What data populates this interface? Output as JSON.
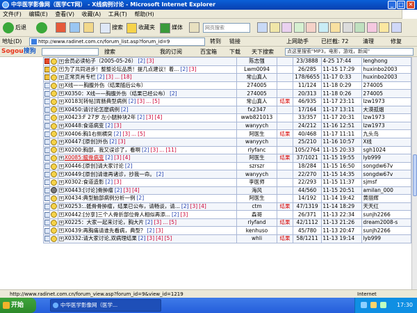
{
  "window": {
    "title": "中华医学影像网（医学CT网） - X线病例讨论 - Microsoft Internet Explorer"
  },
  "menu": [
    "文件(F)",
    "编辑(E)",
    "查看(V)",
    "收藏(A)",
    "工具(T)",
    "帮助(H)"
  ],
  "toolbar": {
    "back": "后退",
    "search": "搜索",
    "favorites": "收藏夹",
    "media": "媒体",
    "web_search_placeholder": "网页搜索",
    "sogou_input": "上网助手",
    "block_ads": "已拦截: 72",
    "clean": "清理",
    "repair": "修复"
  },
  "address": {
    "label": "地址(D)",
    "url": "http://www.radinet.com.cn/forum_list.asp?forum_id=9",
    "go": "转到",
    "links": [
      "链接",
      "上网助手",
      "已拦截: 72",
      "清理",
      "修复"
    ]
  },
  "sogou_bar": {
    "logo_a": "Sogou",
    "logo_b": "搜狗",
    "search": "搜索",
    "items": [
      "我的订阅",
      "百宝箱",
      "下载",
      "天下搜索"
    ],
    "hot": "点这里搜索\"MP3，电影，游戏，新闻\""
  },
  "threads": [
    {
      "icon": "hot",
      "face": "normal",
      "title": "会员必读帖子（2005-05-26）",
      "pages": [
        "[2]",
        "[3]"
      ],
      "author": "陈志强",
      "tag": "",
      "counts": "23/3888",
      "last": "4-25 17:44",
      "last_user": "lenghong"
    },
    {
      "icon": "pic",
      "face": "normal",
      "title": "为了共同进步！整整论坛品质！提几点建议！着...",
      "pages": [
        "[2]",
        "[3]"
      ],
      "author": "Lwm0094",
      "tag": "",
      "counts": "26/285",
      "last": "11-15 17:29",
      "last_user": "huxinbo2003"
    },
    {
      "icon": "pic",
      "face": "normal",
      "title": "正常页肖专栏",
      "pages": [
        "[2]",
        "[3]",
        "...",
        "[18]"
      ],
      "author": "常山真人",
      "tag": "",
      "counts": "178/6655",
      "last": "11-17 0:33",
      "last_user": "huxinbo2003"
    },
    {
      "icon": "normal",
      "face": "normal",
      "title": "X线——胸腹外伤（结果随后公布）",
      "pages": [],
      "author": "274005",
      "tag": "",
      "counts": "11/124",
      "last": "11-18 0:29",
      "last_user": "274005"
    },
    {
      "icon": "normal",
      "face": "normal",
      "title": "X0350：X线——胸腹外伤（结果已经公布）",
      "pages": [
        "[2]"
      ],
      "author": "274005",
      "tag": "",
      "counts": "20/313",
      "last": "11-18 0:26",
      "last_user": "274005"
    },
    {
      "icon": "normal",
      "face": "normal",
      "title": "X0183[转帖]胃肠典型病例",
      "pages": [
        "[2]",
        "[3]",
        "...",
        "[5]"
      ],
      "author": "常山真人",
      "tag": "结果",
      "counts": "46/935",
      "last": "11-17 23:11",
      "last_user": "lzw1973"
    },
    {
      "icon": "normal",
      "face": "normal",
      "title": "X0450:请讨论怎麽病例",
      "pages": [
        "[2]"
      ],
      "author": "fx2347",
      "tag": "",
      "counts": "17/164",
      "last": "11-17 13:11",
      "last_user": "大漠孤烟"
    },
    {
      "icon": "normal",
      "face": "normal",
      "title": "X0423:F 27岁 左小腿肿块2年",
      "pages": [
        "[2]",
        "[3]",
        "[4]"
      ],
      "author": "wwb821013",
      "tag": "",
      "counts": "33/357",
      "last": "11-17 20:31",
      "last_user": "lzw1973"
    },
    {
      "icon": "normal",
      "face": "normal",
      "title": "X0448:食道病变",
      "pages": [
        "[2]",
        "[3]"
      ],
      "author": "wanyych",
      "tag": "",
      "counts": "24/212",
      "last": "11-16 12:51",
      "last_user": "lzw1973"
    },
    {
      "icon": "normal",
      "face": "normal",
      "title": "X0406:胸1右侧横突",
      "pages": [
        "[2]",
        "[3]",
        "...",
        "[5]"
      ],
      "author": "阿医生",
      "tag": "结果",
      "counts": "40/468",
      "last": "11-17 11:11",
      "last_user": "九头鸟"
    },
    {
      "icon": "normal",
      "face": "normal",
      "title": "X0447:[原创]外伤",
      "pages": [
        "[2]",
        "[3]"
      ],
      "author": "wanyych",
      "tag": "",
      "counts": "25/210",
      "last": "11-16 10:57",
      "last_user": "X线"
    },
    {
      "icon": "normal",
      "face": "normal",
      "title": "X0200:胸部，我又误诊了，看啊",
      "pages": [
        "[2]",
        "[3]",
        "...",
        "[11]"
      ],
      "author": "rlyfanc",
      "tag": "",
      "counts": "105/2764",
      "last": "11-15 20:33",
      "last_user": "sgh1024"
    },
    {
      "icon": "normal",
      "face": "normal",
      "title": "X0085:髋骨病变",
      "pages": [
        "[2]",
        "[3]",
        "[4]"
      ],
      "author": "阿医生",
      "tag": "结果",
      "counts": "37/1021",
      "last": "11-15 19:55",
      "last_user": "lyb999",
      "highlight": true
    },
    {
      "icon": "normal",
      "face": "normal",
      "title": "X0446:[原创]请大家讨论",
      "pages": [
        "[2]"
      ],
      "author": "szrszr",
      "tag": "",
      "counts": "18/284",
      "last": "11-15 16:50",
      "last_user": "songdw67v"
    },
    {
      "icon": "normal",
      "face": "normal",
      "title": "X0449:[原创]请谁再诸诊，抄我一命。",
      "pages": [
        "[2]"
      ],
      "author": "wanyych",
      "tag": "",
      "counts": "22/270",
      "last": "11-15 14:35",
      "last_user": "songdw67v"
    },
    {
      "icon": "normal",
      "face": "normal",
      "title": "X0302:食道造影",
      "pages": [
        "[2]",
        "[3]"
      ],
      "author": "李医师",
      "tag": "",
      "counts": "22/293",
      "last": "11-15 11:37",
      "last_user": "sjmsf"
    },
    {
      "icon": "normal",
      "face": "dark",
      "title": "X0443:[讨论]骨肿瘤",
      "pages": [
        "[2]",
        "[3]",
        "[4]"
      ],
      "author": "海风",
      "tag": "",
      "counts": "44/560",
      "last": "11-15 20:51",
      "last_user": "amilan_000"
    },
    {
      "icon": "normal",
      "face": "normal",
      "title": "X0434:典型脑部病例分析一例",
      "pages": [
        "[2]"
      ],
      "author": "阿医生",
      "tag": "",
      "counts": "14/192",
      "last": "11-14 19:42",
      "last_user": "黄丽辉"
    },
    {
      "icon": "normal",
      "face": "normal",
      "title": "X0253:..骶骨骨肿瘤，结果已公布，请畅谈，请...",
      "pages": [
        "[2]",
        "[3]",
        "[4]"
      ],
      "author": "ctm",
      "tag": "结果",
      "counts": "47/1319",
      "last": "11-14 18:29",
      "last_user": "天天红"
    },
    {
      "icon": "normal",
      "face": "normal",
      "title": "X0442:[分享]三个人骨折部位骨人相似再添...",
      "pages": [
        "[2]",
        "[3]"
      ],
      "author": "森哥",
      "tag": "",
      "counts": "26/371",
      "last": "11-13 22:34",
      "last_user": "sunjh2266"
    },
    {
      "icon": "normal",
      "face": "normal",
      "title": "X0225：大家一起来讨论，胸大片",
      "pages": [
        "[2]",
        "[3]",
        "...",
        "[5]"
      ],
      "author": "rlyfand",
      "tag": "结果",
      "counts": "42/1112",
      "last": "11-13 21:26",
      "last_user": "dream2008-s"
    },
    {
      "icon": "normal",
      "face": "normal",
      "title": "X0439:再胸痛请谁先看病，典型？",
      "pages": [
        "[2]",
        "[3]"
      ],
      "author": "kenhuso",
      "tag": "",
      "counts": "45/780",
      "last": "11-13 20:47",
      "last_user": "sunjh2266"
    },
    {
      "icon": "normal",
      "face": "normal",
      "title": "X0332:请大家讨论,双病理结果",
      "pages": [
        "[2]",
        "[3]",
        "[4]",
        "[5]"
      ],
      "author": "whli",
      "tag": "结果",
      "counts": "58/1211",
      "last": "11-13 19:14",
      "last_user": "lyb999"
    }
  ],
  "status": {
    "url": "http://www.radinet.com.cn/forum_view.asp?forum_id=9&view_id=1219",
    "zone": "Internet"
  },
  "taskbar": {
    "start": "开始",
    "task": "中华医学影像网（医学...",
    "clock": "17:30"
  },
  "colors": {
    "title_blue": "#0a5fd8",
    "link_red": "#d40000",
    "taskbar_blue": "#245edb",
    "start_green": "#3fa43c"
  }
}
